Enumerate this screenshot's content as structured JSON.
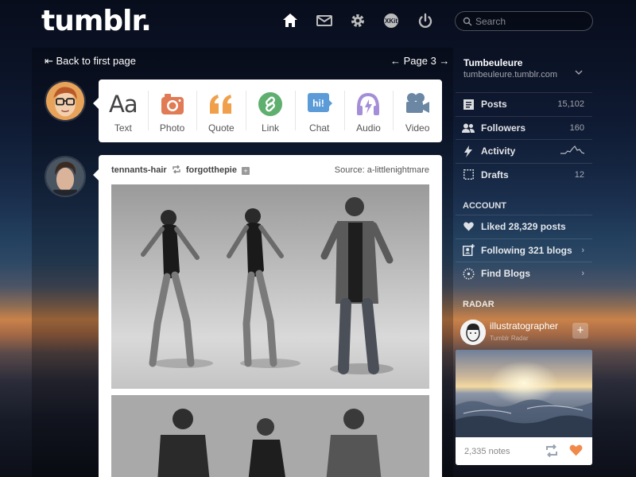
{
  "header": {
    "logo": "tumblr.",
    "nav_icons": [
      "home-icon",
      "mail-icon",
      "gear-icon",
      "xkit-icon",
      "power-icon"
    ],
    "search_placeholder": "Search"
  },
  "pager": {
    "back_label": "⇤ Back to first page",
    "page_label": "← Page 3 →"
  },
  "post_types": [
    {
      "label": "Text",
      "icon": "text-icon",
      "color": "#444444"
    },
    {
      "label": "Photo",
      "icon": "camera-icon",
      "color": "#e07b55"
    },
    {
      "label": "Quote",
      "icon": "quote-icon",
      "color": "#f0a04b"
    },
    {
      "label": "Link",
      "icon": "link-icon",
      "color": "#5faf6e"
    },
    {
      "label": "Chat",
      "icon": "chat-icon",
      "color": "#5a9bd8"
    },
    {
      "label": "Audio",
      "icon": "headphones-icon",
      "color": "#a58ed8"
    },
    {
      "label": "Video",
      "icon": "video-camera-icon",
      "color": "#6b87a3"
    }
  ],
  "post": {
    "user": "tennants-hair",
    "reblogged_from": "forgotthepie",
    "source": "Source: a-littlenightmare"
  },
  "sidebar": {
    "blog_name": "Tumbeuleure",
    "blog_url": "tumbeuleure.tumblr.com",
    "blog_items": [
      {
        "label": "Posts",
        "count": "15,102",
        "icon": "posts-icon"
      },
      {
        "label": "Followers",
        "count": "160",
        "icon": "followers-icon"
      },
      {
        "label": "Activity",
        "count": "",
        "icon": "activity-icon"
      },
      {
        "label": "Drafts",
        "count": "12",
        "icon": "drafts-icon"
      }
    ],
    "account_title": "ACCOUNT",
    "account_items": [
      {
        "label": "Liked 28,329 posts",
        "icon": "heart-icon"
      },
      {
        "label": "Following 321 blogs",
        "icon": "following-icon"
      },
      {
        "label": "Find Blogs",
        "icon": "find-icon"
      }
    ],
    "radar_title": "RADAR",
    "radar": {
      "user": "illustratographer",
      "sub": "Tumblr Radar",
      "notes": "2,335 notes"
    }
  },
  "colors": {
    "like": "#f08a4b",
    "accent_text": "#ffffff"
  }
}
